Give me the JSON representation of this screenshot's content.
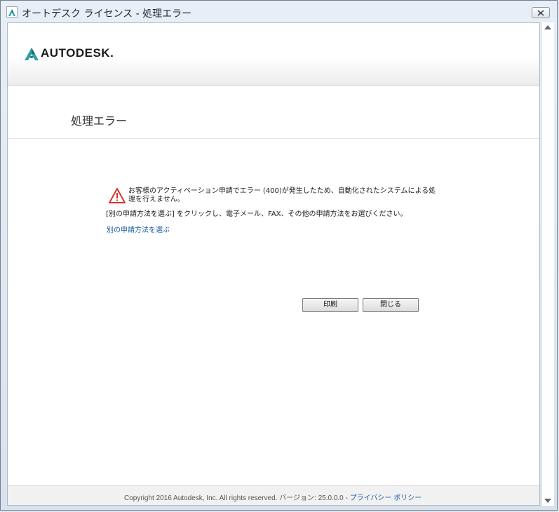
{
  "window": {
    "title": "オートデスク ライセンス - 処理エラー"
  },
  "header": {
    "logo_text": "AUTODESK."
  },
  "page": {
    "title": "処理エラー"
  },
  "error": {
    "message": "お客様のアクティベーション申請でエラー (400)が発生したため、自動化されたシステムによる処理を行えません。",
    "hint": "[別の申請方法を選ぶ] をクリックし、電子メール、FAX、その他の申請方法をお選びください。",
    "link_label": "別の申請方法を選ぶ"
  },
  "buttons": {
    "print_label": "印刷",
    "close_label": "閉じる"
  },
  "footer": {
    "copyright": "Copyright 2016 Autodesk, Inc. All rights reserved. バージョン: 25.0.0.0 - ",
    "privacy_label": "プライバシー ポリシー"
  },
  "colors": {
    "link": "#1a5c9e",
    "warning": "#d9342b",
    "logo_teal": "#2f9fa7"
  },
  "icons": {
    "app": "autodesk-app-icon",
    "close": "close-x-icon",
    "warning": "warning-triangle-icon"
  }
}
